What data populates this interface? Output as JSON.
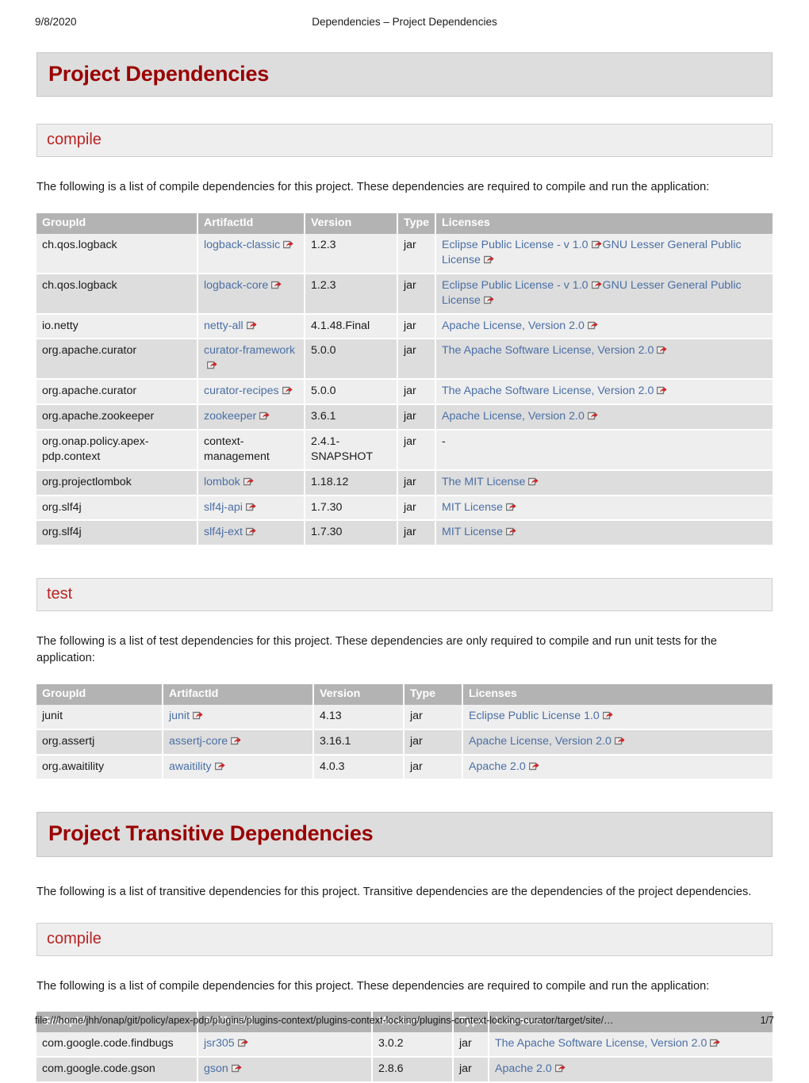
{
  "print_header": {
    "date": "9/8/2020",
    "title": "Dependencies – Project Dependencies"
  },
  "print_footer": {
    "url": "file:///home/jhh/onap/git/policy/apex-pdp/plugins/plugins-context/plugins-context-locking/plugins-context-locking-curator/target/site/…",
    "page": "1/7"
  },
  "icons": {
    "external_link": "external-link-icon"
  },
  "colors": {
    "heading": "#990000",
    "subheading": "#bb2222",
    "link": "#4a6fa5",
    "table_header_bg": "#b3b3b3",
    "row_odd_bg": "#eeeeee",
    "row_even_bg": "#dddddd",
    "banner_h1_bg": "#dddddd",
    "banner_h2_bg": "#eeeeee"
  },
  "sections": {
    "project_dependencies": {
      "title": "Project Dependencies",
      "compile": {
        "subtitle": "compile",
        "paragraph": "The following is a list of compile dependencies for this project. These dependencies are required to compile and run the application:",
        "columns": [
          "GroupId",
          "ArtifactId",
          "Version",
          "Type",
          "Licenses"
        ],
        "col_widths": [
          "203px",
          "135px",
          "117px",
          "48px",
          "425px"
        ],
        "rows": [
          {
            "groupId": "ch.qos.logback",
            "artifactId": "logback-classic",
            "artifactLink": true,
            "version": "1.2.3",
            "type": "jar",
            "licenses": [
              {
                "name": "Eclipse Public License - v 1.0",
                "link": true
              },
              {
                "name": "GNU Lesser General Public License",
                "link": true
              }
            ]
          },
          {
            "groupId": "ch.qos.logback",
            "artifactId": "logback-core",
            "artifactLink": true,
            "version": "1.2.3",
            "type": "jar",
            "licenses": [
              {
                "name": "Eclipse Public License - v 1.0",
                "link": true
              },
              {
                "name": "GNU Lesser General Public License",
                "link": true
              }
            ]
          },
          {
            "groupId": "io.netty",
            "artifactId": "netty-all",
            "artifactLink": true,
            "version": "4.1.48.Final",
            "type": "jar",
            "licenses": [
              {
                "name": "Apache License, Version 2.0",
                "link": true
              }
            ]
          },
          {
            "groupId": "org.apache.curator",
            "artifactId": "curator-framework",
            "artifactLink": true,
            "version": "5.0.0",
            "type": "jar",
            "licenses": [
              {
                "name": "The Apache Software License, Version 2.0",
                "link": true
              }
            ]
          },
          {
            "groupId": "org.apache.curator",
            "artifactId": "curator-recipes",
            "artifactLink": true,
            "version": "5.0.0",
            "type": "jar",
            "licenses": [
              {
                "name": "The Apache Software License, Version 2.0",
                "link": true
              }
            ]
          },
          {
            "groupId": "org.apache.zookeeper",
            "artifactId": "zookeeper",
            "artifactLink": true,
            "version": "3.6.1",
            "type": "jar",
            "licenses": [
              {
                "name": "Apache License, Version 2.0",
                "link": true
              }
            ]
          },
          {
            "groupId": "org.onap.policy.apex-pdp.context",
            "artifactId": "context-management",
            "artifactLink": false,
            "version": "2.4.1-SNAPSHOT",
            "type": "jar",
            "licenses": [
              {
                "name": "-",
                "link": false
              }
            ]
          },
          {
            "groupId": "org.projectlombok",
            "artifactId": "lombok",
            "artifactLink": true,
            "version": "1.18.12",
            "type": "jar",
            "licenses": [
              {
                "name": "The MIT License",
                "link": true
              }
            ]
          },
          {
            "groupId": "org.slf4j",
            "artifactId": "slf4j-api",
            "artifactLink": true,
            "version": "1.7.30",
            "type": "jar",
            "licenses": [
              {
                "name": "MIT License",
                "link": true
              }
            ]
          },
          {
            "groupId": "org.slf4j",
            "artifactId": "slf4j-ext",
            "artifactLink": true,
            "version": "1.7.30",
            "type": "jar",
            "licenses": [
              {
                "name": "MIT License",
                "link": true
              }
            ]
          }
        ]
      },
      "test": {
        "subtitle": "test",
        "paragraph": "The following is a list of test dependencies for this project. These dependencies are only required to compile and run unit tests for the application:",
        "columns": [
          "GroupId",
          "ArtifactId",
          "Version",
          "Type",
          "Licenses"
        ],
        "col_widths": [
          "159px",
          "190px",
          "114px",
          "74px",
          "391px"
        ],
        "rows": [
          {
            "groupId": "junit",
            "artifactId": "junit",
            "artifactLink": true,
            "version": "4.13",
            "type": "jar",
            "licenses": [
              {
                "name": "Eclipse Public License 1.0",
                "link": true
              }
            ]
          },
          {
            "groupId": "org.assertj",
            "artifactId": "assertj-core",
            "artifactLink": true,
            "version": "3.16.1",
            "type": "jar",
            "licenses": [
              {
                "name": "Apache License, Version 2.0",
                "link": true
              }
            ]
          },
          {
            "groupId": "org.awaitility",
            "artifactId": "awaitility",
            "artifactLink": true,
            "version": "4.0.3",
            "type": "jar",
            "licenses": [
              {
                "name": "Apache 2.0",
                "link": true
              }
            ]
          }
        ]
      }
    },
    "project_transitive_dependencies": {
      "title": "Project Transitive Dependencies",
      "paragraph": "The following is a list of transitive dependencies for this project. Transitive dependencies are the dependencies of the project dependencies.",
      "compile": {
        "subtitle": "compile",
        "paragraph": "The following is a list of compile dependencies for this project. These dependencies are required to compile and run the application:",
        "columns": [
          "GroupId",
          "ArtifactId",
          "Version",
          "Type",
          "Licenses"
        ],
        "col_widths": [
          "203px",
          "220px",
          "102px",
          "45px",
          "358px"
        ],
        "rows": [
          {
            "groupId": "com.google.code.findbugs",
            "artifactId": "jsr305",
            "artifactLink": true,
            "version": "3.0.2",
            "type": "jar",
            "licenses": [
              {
                "name": "The Apache Software License, Version 2.0",
                "link": true
              }
            ]
          },
          {
            "groupId": "com.google.code.gson",
            "artifactId": "gson",
            "artifactLink": true,
            "version": "2.8.6",
            "type": "jar",
            "licenses": [
              {
                "name": "Apache 2.0",
                "link": true
              }
            ]
          }
        ]
      }
    }
  }
}
